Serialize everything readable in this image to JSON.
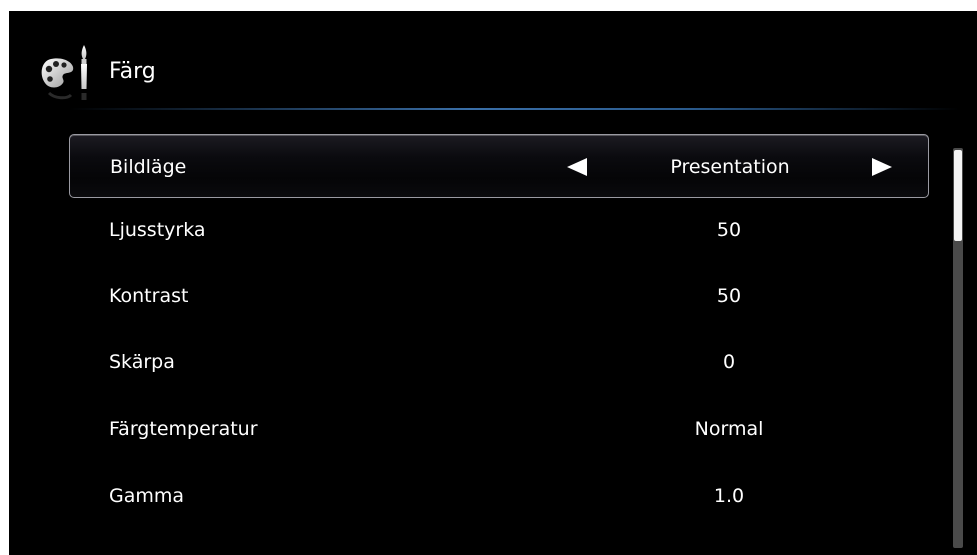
{
  "header": {
    "title": "Färg",
    "icon": "palette-brush-icon"
  },
  "menu": {
    "items": [
      {
        "label": "Bildläge",
        "value": "Presentation",
        "selected": true
      },
      {
        "label": "Ljusstyrka",
        "value": "50",
        "selected": false
      },
      {
        "label": "Kontrast",
        "value": "50",
        "selected": false
      },
      {
        "label": "Skärpa",
        "value": "0",
        "selected": false
      },
      {
        "label": "Färgtemperatur",
        "value": "Normal",
        "selected": false
      },
      {
        "label": "Gamma",
        "value": "1.0",
        "selected": false
      }
    ],
    "left_arrow_icon": "triangle-left-icon",
    "right_arrow_icon": "triangle-right-icon"
  },
  "scrollbar": {
    "visible_fraction": 0.23,
    "position_fraction": 0.0
  },
  "colors": {
    "background": "#000000",
    "text": "#ffffff",
    "divider_accent": "#3a6fa8",
    "selection_border": "#9a9aa2"
  }
}
